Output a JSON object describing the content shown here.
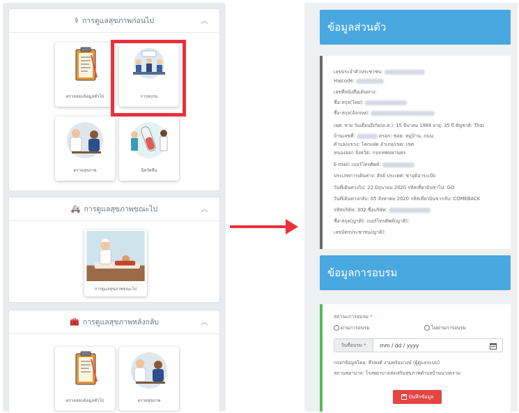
{
  "left": {
    "sections": [
      {
        "title": "การดูแลสุขภาพก่อนไป",
        "icon": "stethoscope-icon",
        "cards": [
          {
            "caption": "ตรวจสอบข้อมูลทั่วไป",
            "icon": "clipboard-icon"
          },
          {
            "caption": "การอบรม",
            "icon": "meeting-icon"
          },
          {
            "caption": "ตรวจสุขภาพ",
            "icon": "doctor-checkup-icon"
          },
          {
            "caption": "ฉีดวัคซีน",
            "icon": "vaccine-icon"
          }
        ]
      },
      {
        "title": "การดูแลสุขภาพขณะไป",
        "icon": "ambulance-icon",
        "cards": [
          {
            "caption": "การดูแลสุขภาพขณะไป",
            "icon": "nurse-care-icon"
          }
        ]
      },
      {
        "title": "การดูแลสุขภาพหลังกลับ",
        "icon": "medkit-icon",
        "cards": [
          {
            "caption": "ตรวจสอบข้อมูลทั่วไป",
            "icon": "clipboard-icon"
          },
          {
            "caption": "ตรวจสุขภาพ",
            "icon": "doctor-checkup-icon"
          }
        ]
      }
    ],
    "highlight_color": "#e8313b"
  },
  "right": {
    "personal": {
      "title": "ข้อมูลส่วนตัว",
      "lines": [
        "เลขประจำตัวประชาชน:",
        "Hajcode:",
        "เลขที่หนังสือเดินทาง:",
        "ชื่อ-สกุล(ไทย):",
        "ชื่อ-สกุล(อังกฤษ):",
        "เพศ: ชาย วันเดือนปีเกิด(ค.ศ.): 15 มีนาคม 1984 อายุ: 35 ปี สัญชาติ: Thai",
        "บ้านเลขที่:",
        "ตรอก: ซอย: หมู่บ้าน: ถนน:",
        "ตำบล/แขวง: โคกแฝด อำเภอ/เขต: เขต",
        "หนองจอก จังหวัด: กรุงเทพมหานคร",
        "E-mail: เบอร์โทรศัพท์:",
        "ประเภทการเดินทาง: ฮัจย์ ประเทศ: ซาอุดิอาระเบีย",
        "วันที่เดินทางไป: 22 มิถุนายน 2020 รหัสเที่ยวบินขาไป: GO",
        "วันที่เดินทางกลับ: 05 สิงหาคม 2020 รหัสเที่ยวบินขากลับ: COMEBACK",
        "รหัสบริษัท: 302 ชื่อบริษัท:",
        "ชื่อ-สกุล(ญาติ): เบอร์โทรศัพท์(ญาติ):",
        "เลขบัตรประชาชน(ญาติ):"
      ]
    },
    "training": {
      "title": "ข้อมูลการอบรม",
      "status_label": "สถานะการอบรม",
      "required_mark": "*",
      "option_pass": "ผ่านการอบรม",
      "option_fail": "ไม่ผ่านการอบรม",
      "date_label": "วันที่อบรม",
      "date_placeholder": "mm / dd / yyyy",
      "recorder": "กรอกข้อมูลโดย: ธีรพงศ์ งามพร้อมวงษ์ (ผู้ดูแลระบบ)",
      "hospital": "สถานพยาบาล: โรงพยาบาลส่งเสริมสุขภาพตำบลบ้านบางคราม",
      "save_label": "บันทึกข้อมูล"
    },
    "colors": {
      "header_blue": "#4aa8e0",
      "save_red": "#e34545",
      "success_green": "#59b85c"
    }
  }
}
